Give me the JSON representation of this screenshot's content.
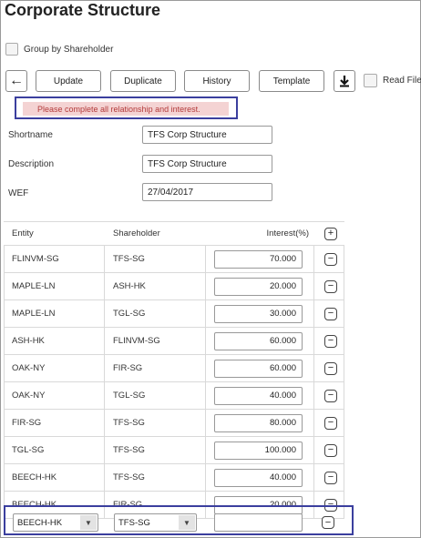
{
  "page": {
    "title": "Corporate Structure"
  },
  "options": {
    "group_by_shareholder_label": "Group by Shareholder",
    "read_file_label": "Read File"
  },
  "toolbar": {
    "back_icon": "←",
    "update_label": "Update",
    "duplicate_label": "Duplicate",
    "history_label": "History",
    "template_label": "Template",
    "download_icon": "🡇"
  },
  "error": {
    "message": "Please complete all relationship and interest."
  },
  "form": {
    "shortname_label": "Shortname",
    "shortname_value": "TFS Corp Structure",
    "description_label": "Description",
    "description_value": "TFS Corp Structure",
    "wef_label": "WEF",
    "wef_value": "27/04/2017"
  },
  "table": {
    "headers": {
      "entity": "Entity",
      "shareholder": "Shareholder",
      "interest": "Interest(%)",
      "add_icon": "+"
    },
    "rows": [
      {
        "entity": "FLINVM-SG",
        "shareholder": "TFS-SG",
        "interest": "70.000"
      },
      {
        "entity": "MAPLE-LN",
        "shareholder": "ASH-HK",
        "interest": "20.000"
      },
      {
        "entity": "MAPLE-LN",
        "shareholder": "TGL-SG",
        "interest": "30.000"
      },
      {
        "entity": "ASH-HK",
        "shareholder": "FLINVM-SG",
        "interest": "60.000"
      },
      {
        "entity": "OAK-NY",
        "shareholder": "FIR-SG",
        "interest": "60.000"
      },
      {
        "entity": "OAK-NY",
        "shareholder": "TGL-SG",
        "interest": "40.000"
      },
      {
        "entity": "FIR-SG",
        "shareholder": "TFS-SG",
        "interest": "80.000"
      },
      {
        "entity": "TGL-SG",
        "shareholder": "TFS-SG",
        "interest": "100.000"
      },
      {
        "entity": "BEECH-HK",
        "shareholder": "TFS-SG",
        "interest": "40.000"
      },
      {
        "entity": "BEECH-HK",
        "shareholder": "FIR-SG",
        "interest": "20.000"
      }
    ],
    "remove_icon": "−",
    "new_row": {
      "entity": "BEECH-HK",
      "shareholder": "TFS-SG",
      "interest": "",
      "dropdown_icon": "▼"
    }
  }
}
